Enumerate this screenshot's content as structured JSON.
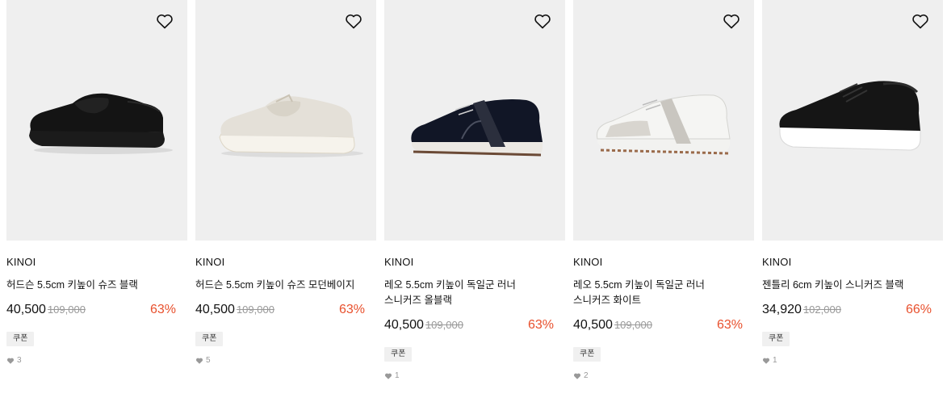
{
  "products": [
    {
      "brand": "KINOI",
      "name": "허드슨 5.5cm 키높이 슈즈 블랙",
      "price": "40,500",
      "original_price": "109,000",
      "discount": "63%",
      "coupon": "쿠폰",
      "likes": "3",
      "shoe_color": "#111111",
      "sole_color": "#1a1a1a"
    },
    {
      "brand": "KINOI",
      "name": "허드슨 5.5cm 키높이 슈즈 모던베이지",
      "price": "40,500",
      "original_price": "109,000",
      "discount": "63%",
      "coupon": "쿠폰",
      "likes": "5",
      "shoe_color": "#e6e2da",
      "sole_color": "#f4f1ea"
    },
    {
      "brand": "KINOI",
      "name": "레오 5.5cm 키높이 독일군 러너 스니커즈 올블랙",
      "price": "40,500",
      "original_price": "109,000",
      "discount": "63%",
      "coupon": "쿠폰",
      "likes": "1",
      "shoe_color": "#14182a",
      "sole_color": "#e9e6e1"
    },
    {
      "brand": "KINOI",
      "name": "레오 5.5cm 키높이 독일군 러너 스니커즈 화이트",
      "price": "40,500",
      "original_price": "109,000",
      "discount": "63%",
      "coupon": "쿠폰",
      "likes": "2",
      "shoe_color": "#f3f3f1",
      "sole_color": "#eeeeea"
    },
    {
      "brand": "KINOI",
      "name": "젠틀리 6cm 키높이 스니커즈 블랙",
      "price": "34,920",
      "original_price": "102,000",
      "discount": "66%",
      "coupon": "쿠폰",
      "likes": "1",
      "shoe_color": "#141414",
      "sole_color": "#ffffff"
    }
  ],
  "colors": {
    "discount": "#e8502d",
    "thumb_bg": "#efefef",
    "coupon_bg": "#f0f0f0"
  }
}
